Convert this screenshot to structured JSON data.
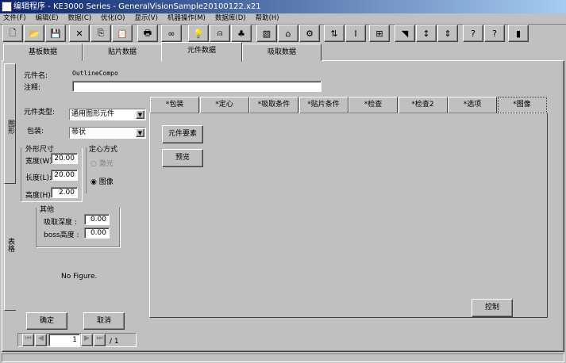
{
  "window": {
    "title": "编辑程序 - KE3000 Series - GeneralVisionSample20100122.x21"
  },
  "menu": [
    "文件(F)",
    "编辑(E)",
    "数据(C)",
    "优化(O)",
    "显示(V)",
    "机器操作(M)",
    "数据库(D)",
    "帮助(H)"
  ],
  "toolbar": [
    {
      "icon": "new-file-icon",
      "glyph": "🗋"
    },
    {
      "icon": "open-folder-icon",
      "glyph": "📂"
    },
    {
      "icon": "save-icon",
      "glyph": "💾"
    },
    {
      "icon": "cut-icon",
      "glyph": "✕"
    },
    {
      "icon": "copy-icon",
      "glyph": "⎘"
    },
    {
      "icon": "paste-icon",
      "glyph": "📋"
    },
    {
      "icon": "print-icon",
      "glyph": "🖶"
    },
    {
      "icon": "glasses-icon",
      "glyph": "∞"
    },
    {
      "icon": "lightbulb-icon",
      "glyph": "💡"
    },
    {
      "icon": "nozzle-icon",
      "glyph": "⍝"
    },
    {
      "icon": "shapes-icon",
      "glyph": "♣"
    },
    {
      "icon": "grayed-tool-icon",
      "glyph": "▧"
    },
    {
      "icon": "feeder-icon",
      "glyph": "⌂"
    },
    {
      "icon": "component-icon",
      "glyph": "⚙"
    },
    {
      "icon": "swap-icon",
      "glyph": "⇅"
    },
    {
      "icon": "ibeam-icon",
      "glyph": "I"
    },
    {
      "icon": "board-icon",
      "glyph": "⊞"
    },
    {
      "icon": "grayed-arrow-icon",
      "glyph": "◥"
    },
    {
      "icon": "height-icon",
      "glyph": "↕"
    },
    {
      "icon": "stack-height-icon",
      "glyph": "⇕"
    },
    {
      "icon": "context-help-icon",
      "glyph": "?"
    },
    {
      "icon": "help-icon",
      "glyph": "?"
    },
    {
      "icon": "exit-door-icon",
      "glyph": "▮"
    }
  ],
  "top_tabs": [
    "基板数据",
    "贴片数据",
    "元件数据",
    "吸取数据"
  ],
  "active_top_tab": 2,
  "side_tabs": [
    "图形",
    "表格"
  ],
  "form": {
    "name_label": "元件名:",
    "name_value": "OutlineCompo",
    "comment_label": "注释:",
    "comment_value": "",
    "type_label": "元件类型:",
    "type_value": "通用图形元件",
    "package_label": "包装:",
    "package_value": "带状",
    "size_group": "外形尺寸",
    "width_label": "宽度(W):",
    "width_value": "20.00",
    "length_label": "长度(L):",
    "length_value": "20.00",
    "height_label": "高度(H):",
    "height_value": "2.00",
    "centering_group": "定心方式",
    "laser_label": "激光",
    "image_label": "图像",
    "centering_selected": "图像",
    "other_group": "其他",
    "pick_depth_label": "吸取深度 :",
    "pick_depth_value": "0.00",
    "boss_label": "boss高度 :",
    "boss_value": "0.00",
    "no_figure": "No Figure."
  },
  "inner_tabs": [
    "*包装",
    "*定心",
    "*吸取条件",
    "*贴片条件",
    "*检查",
    "*检查2",
    "*选项",
    "*图像"
  ],
  "active_inner_tab": 7,
  "inner_buttons": {
    "elements": "元件要素",
    "preview": "预览",
    "control": "控制"
  },
  "buttons": {
    "ok": "确定",
    "cancel": "取消"
  },
  "pager": {
    "current": "1",
    "total": "/ 1"
  }
}
